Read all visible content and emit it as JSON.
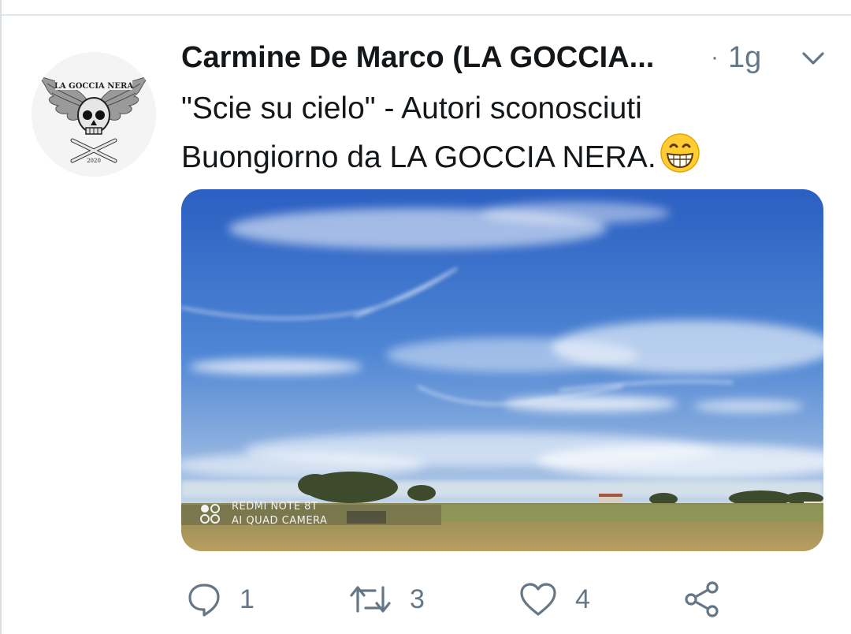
{
  "tweet": {
    "author": {
      "display_name": "Carmine De Marco (LA GOCCIA...",
      "avatar_text": "LA GOCCIA NERA",
      "avatar_year": "2020",
      "avatar_icon": "winged-skull-logo"
    },
    "separator": "·",
    "time_ago": "1g",
    "text_lines": [
      "\"Scie su cielo\" - Autori sconosciuti",
      "Buongiorno da LA GOCCIA NERA."
    ],
    "emoji": "grinning-face-emoji",
    "media": {
      "watermark_line1": "REDMI NOTE 8T",
      "watermark_line2": "AI QUAD CAMERA"
    },
    "actions": {
      "reply_count": "1",
      "retweet_count": "3",
      "like_count": "4"
    }
  },
  "colors": {
    "text": "#14171a",
    "secondary": "#657786",
    "sky_top": "#2f63c4",
    "sky_bottom": "#c9d8ea",
    "field": "#a9945a"
  }
}
